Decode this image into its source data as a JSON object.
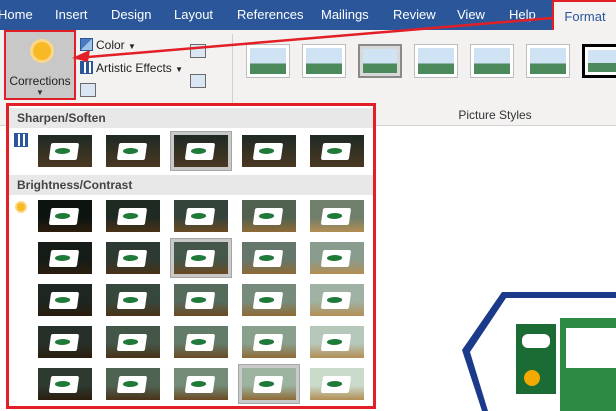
{
  "tabs": [
    {
      "label": "Home"
    },
    {
      "label": "Insert"
    },
    {
      "label": "Design"
    },
    {
      "label": "Layout"
    },
    {
      "label": "References"
    },
    {
      "label": "Mailings"
    },
    {
      "label": "Review"
    },
    {
      "label": "View"
    },
    {
      "label": "Help"
    },
    {
      "label": "Format"
    }
  ],
  "ribbon": {
    "corrections_label": "Corrections",
    "color_label": "Color",
    "artistic_effects_label": "Artistic Effects",
    "picture_styles_label": "Picture Styles"
  },
  "gallery": {
    "sharpen_header": "Sharpen/Soften",
    "brightness_header": "Brightness/Contrast",
    "sharpen_selected_index": 2,
    "brightness_selected": [
      [
        1,
        2
      ],
      [
        4,
        3
      ]
    ]
  },
  "colors": {
    "ribbon_blue": "#2b579a",
    "highlight_red": "#e21f26"
  },
  "icons": {
    "corrections": "sun-icon",
    "color": "color-icon",
    "artistic": "artistic-effects-icon",
    "sharpen_row": "sharpen-icon",
    "brightness_row": "brightness-icon"
  }
}
